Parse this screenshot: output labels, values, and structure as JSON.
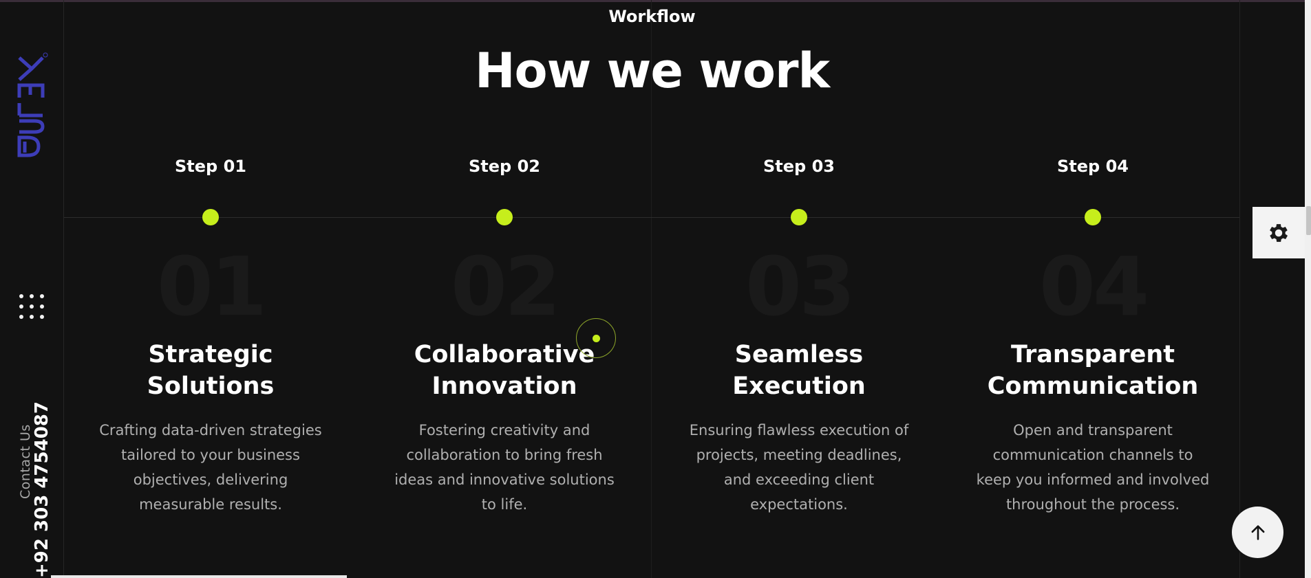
{
  "header": {
    "eyebrow": "Workflow",
    "title": "How we work"
  },
  "sidebar": {
    "logo_icon": "dtek-logo",
    "menu_icon": "grid-dots-icon",
    "contact_label": "Contact Us",
    "contact_phone": "+92 303 4754087"
  },
  "steps": [
    {
      "label": "Step 01",
      "number": "01",
      "title_line1": "Strategic",
      "title_line2": "Solutions",
      "desc": "Crafting data-driven strategies tailored to your business objectives, delivering measurable results."
    },
    {
      "label": "Step 02",
      "number": "02",
      "title_line1": "Collaborative",
      "title_line2": "Innovation",
      "desc": "Fostering creativity and collaboration to bring fresh ideas and innovative solutions to life."
    },
    {
      "label": "Step 03",
      "number": "03",
      "title_line1": "Seamless",
      "title_line2": "Execution",
      "desc": "Ensuring flawless execution of projects, meeting deadlines, and exceeding client expectations."
    },
    {
      "label": "Step 04",
      "number": "04",
      "title_line1": "Transparent",
      "title_line2": "Communication",
      "desc": "Open and transparent communication channels to keep you informed and involved throughout the process."
    }
  ],
  "widgets": {
    "settings_icon": "gear-icon",
    "scroll_top_icon": "arrow-up-icon"
  },
  "colors": {
    "background": "#121212",
    "accent": "#c6ee1c",
    "logo": "#3d3db8",
    "text": "#ffffff",
    "muted_text": "#b0b0b0"
  }
}
